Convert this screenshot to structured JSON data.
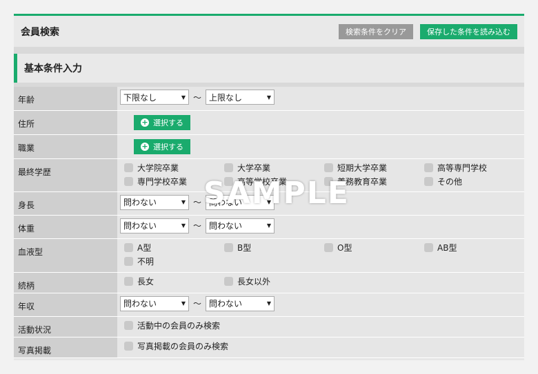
{
  "header": {
    "title": "会員検索",
    "clear_label": "検索条件をクリア",
    "load_label": "保存した条件を読み込む"
  },
  "section_title": "基本条件入力",
  "rows": {
    "age": {
      "label": "年齢",
      "from": "下限なし",
      "to": "上限なし"
    },
    "address": {
      "label": "住所",
      "button": "選択する"
    },
    "job": {
      "label": "職業",
      "button": "選択する"
    },
    "education": {
      "label": "最終学歴",
      "options": [
        "大学院卒業",
        "大学卒業",
        "短期大学卒業",
        "高等専門学校",
        "専門学校卒業",
        "高等学校卒業",
        "義務教育卒業",
        "その他"
      ]
    },
    "height": {
      "label": "身長",
      "from": "問わない",
      "to": "問わない"
    },
    "weight": {
      "label": "体重",
      "from": "問わない",
      "to": "問わない"
    },
    "blood": {
      "label": "血液型",
      "options": [
        "A型",
        "B型",
        "O型",
        "AB型",
        "不明"
      ]
    },
    "sibling": {
      "label": "続柄",
      "options": [
        "長女",
        "長女以外"
      ]
    },
    "income": {
      "label": "年収",
      "from": "問わない",
      "to": "問わない"
    },
    "activity": {
      "label": "活動状況",
      "option": "活動中の会員のみ検索"
    },
    "photo": {
      "label": "写真掲載",
      "option": "写真掲載の会員のみ検索"
    }
  },
  "tilde": "〜",
  "watermark": "SAMPLE",
  "colors": {
    "accent": "#1aab6d",
    "gray_button": "#999999"
  }
}
